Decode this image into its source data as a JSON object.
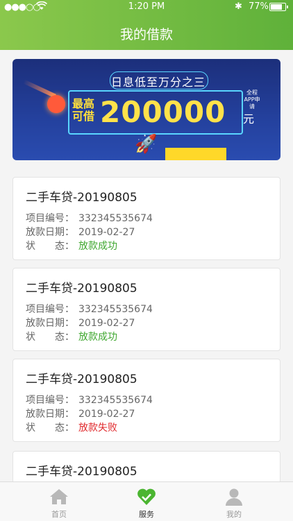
{
  "status": {
    "signal": "●●●○○",
    "time": "1:20 PM",
    "battery": "77%"
  },
  "header": {
    "title": "我的借款"
  },
  "banner": {
    "headline": "日息低至万分之三",
    "max_label": "最高可借",
    "amount": "200000",
    "unit": "元",
    "side_text": "全程APP申请"
  },
  "loans": [
    {
      "name": "二手车贷-20190805",
      "id_label": "项目编号：",
      "id": "332345535674",
      "date_label": "放款日期：",
      "date": "2019-02-27",
      "status_label": "状　　态：",
      "status": "放款成功"
    },
    {
      "name": "二手车贷-20190805",
      "id_label": "项目编号：",
      "id": "332345535674",
      "date_label": "放款日期：",
      "date": "2019-02-27",
      "status_label": "状　　态：",
      "status": "放款成功"
    },
    {
      "name": "二手车贷-20190805",
      "id_label": "项目编号：",
      "id": "332345535674",
      "date_label": "放款日期：",
      "date": "2019-02-27",
      "status_label": "状　　态：",
      "status": "放款失败"
    },
    {
      "name": "二手车贷-20190805"
    }
  ],
  "tabs": [
    {
      "label": "首页",
      "icon": "home-icon"
    },
    {
      "label": "服务",
      "icon": "heart-icon"
    },
    {
      "label": "我的",
      "icon": "user-icon"
    }
  ],
  "colors": {
    "accent": "#5fb13a",
    "success": "#3fa72f",
    "fail": "#e0292c"
  }
}
